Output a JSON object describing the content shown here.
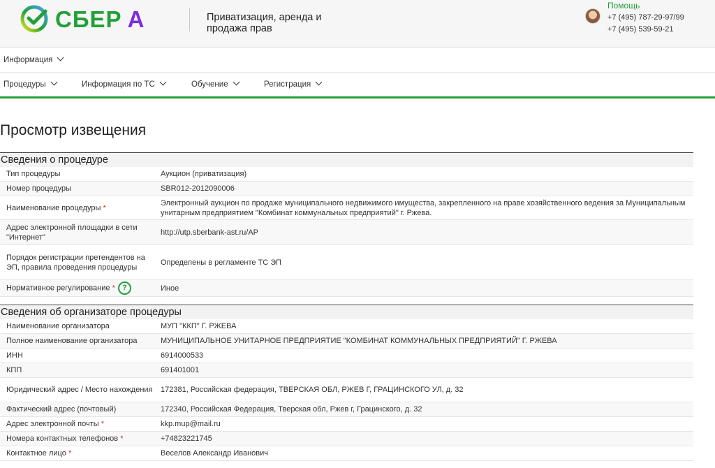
{
  "header": {
    "brand_main": "СБЕР",
    "brand_accent": "А",
    "tagline": "Приватизация, аренда и продажа прав",
    "help_label": "Помощь",
    "phone1": "+7 (495) 787-29-97/99",
    "phone2": "+7 (495) 539-59-21"
  },
  "nav": {
    "row1": [
      {
        "label": "Информация"
      }
    ],
    "row2": [
      {
        "label": "Процедуры"
      },
      {
        "label": "Информация по ТС"
      },
      {
        "label": "Обучение"
      },
      {
        "label": "Регистрация"
      }
    ]
  },
  "page_title": "Просмотр извещения",
  "procedure": {
    "title": "Сведения о процедуре",
    "rows": [
      {
        "label": "Тип процедуры",
        "value": "Аукцион (приватизация)"
      },
      {
        "label": "Номер процедуры",
        "value": "SBR012-2012090006"
      },
      {
        "label": "Наименование процедуры",
        "value": "Электронный аукцион по продаже муниципального недвижимого имущества, закрепленного на праве хозяйственного ведения за Муниципальным унитарным предприятием \"Комбинат коммунальных предприятий\" г. Ржева."
      },
      {
        "label": "Адрес электронной площадки в сети \"Интернет\"",
        "value": "http://utp.sberbank-ast.ru/AP"
      },
      {
        "label": "Порядок регистрации претендентов на ЭП, правила проведения процедуры",
        "value": "Определены в регламенте ТС ЭП"
      },
      {
        "label": "Нормативное регулирование",
        "value": "Иное"
      }
    ]
  },
  "organizer": {
    "title": "Сведения об организаторе процедуры",
    "rows": [
      {
        "label": "Наименование организатора",
        "value": "МУП \"ККП\" Г. РЖЕВА"
      },
      {
        "label": "Полное наименование организатора",
        "value": "МУНИЦИПАЛЬНОЕ УНИТАРНОЕ ПРЕДПРИЯТИЕ \"КОМБИНАТ КОММУНАЛЬНЫХ ПРЕДПРИЯТИЙ\" Г. РЖЕВА"
      },
      {
        "label": "ИНН",
        "value": "6914000533"
      },
      {
        "label": "КПП",
        "value": "691401001"
      },
      {
        "label": "Юридический адрес / Место нахождения",
        "value": "172381, Российская федерация, ТВЕРСКАЯ ОБЛ, РЖЕВ Г, ГРАЦИНСКОГО УЛ, д. 32"
      },
      {
        "label": "Фактический адрес (почтовый)",
        "value": "172340, Российская Федерация, Тверская обл, Ржев г, Грацинского, д. 32"
      },
      {
        "label": "Адрес электронной почты",
        "value": "kkp.mup@mail.ru"
      },
      {
        "label": "Номера контактных телефонов",
        "value": "+74823221745"
      },
      {
        "label": "Контактное лицо",
        "value": "Веселов Александр Иванович"
      }
    ]
  },
  "required_mark": "*",
  "help_glyph": "?",
  "colors": {
    "brand_green": "#21a038",
    "brand_purple": "#7d2ee0",
    "required": "#d03030"
  }
}
